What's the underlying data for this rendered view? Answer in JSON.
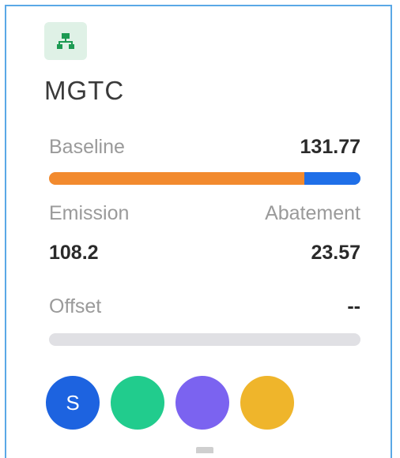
{
  "card": {
    "icon": "hierarchy-icon",
    "title": "MGTC",
    "baseline": {
      "label": "Baseline",
      "value": "131.77"
    },
    "emission": {
      "label": "Emission",
      "value": "108.2"
    },
    "abatement": {
      "label": "Abatement",
      "value": "23.57"
    },
    "offset": {
      "label": "Offset",
      "value": "--"
    },
    "progress": {
      "emission_fraction": 0.821,
      "abatement_fraction": 0.179
    },
    "avatars": [
      {
        "label": "S",
        "color": "#1d63e0"
      },
      {
        "label": "",
        "color": "#21cc8d"
      },
      {
        "label": "",
        "color": "#7b63f0"
      },
      {
        "label": "",
        "color": "#efb52b"
      }
    ]
  },
  "colors": {
    "emission": "#f28a2e",
    "abatement": "#1f6fe8",
    "icon": "#1c9a52",
    "border": "#5aa8e6"
  }
}
